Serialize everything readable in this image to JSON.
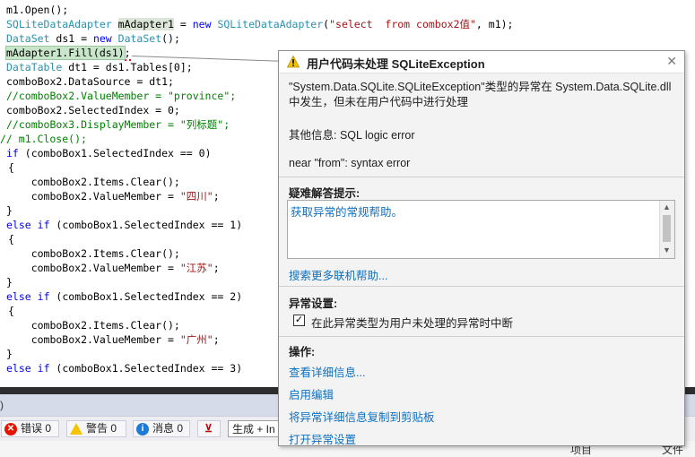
{
  "code": {
    "lines": [
      [
        {
          "t": "m1.Open();",
          "c": ""
        }
      ],
      [
        {
          "t": "SQLiteDataAdapter",
          "c": "ty"
        },
        {
          "t": " ",
          "c": ""
        },
        {
          "t": "mAdapter1",
          "c": "hl-var"
        },
        {
          "t": " = ",
          "c": ""
        },
        {
          "t": "new",
          "c": "kw"
        },
        {
          "t": " ",
          "c": ""
        },
        {
          "t": "SQLiteDataAdapter",
          "c": "ty"
        },
        {
          "t": "(",
          "c": ""
        },
        {
          "t": "\"select  from combox2值\"",
          "c": "st"
        },
        {
          "t": ", m1);",
          "c": ""
        }
      ],
      [
        {
          "t": "DataSet",
          "c": "ty"
        },
        {
          "t": " ds1 = ",
          "c": ""
        },
        {
          "t": "new",
          "c": "kw"
        },
        {
          "t": " ",
          "c": ""
        },
        {
          "t": "DataSet",
          "c": "ty"
        },
        {
          "t": "();",
          "c": ""
        }
      ],
      [
        {
          "t": "mAdapter1.Fill(ds1)",
          "c": "hl-fill"
        },
        {
          "t": ";",
          "c": "squiggle"
        }
      ],
      [
        {
          "t": "DataTable",
          "c": "ty"
        },
        {
          "t": " dt1 = ds1.Tables[0];",
          "c": ""
        }
      ],
      [
        {
          "t": "comboBox2.DataSource = dt1;",
          "c": ""
        }
      ],
      [
        {
          "t": "//comboBox2.ValueMember = \"province\";",
          "c": "cm"
        }
      ],
      [
        {
          "t": "comboBox2.SelectedIndex = 0;",
          "c": ""
        }
      ],
      [
        {
          "t": "//comboBox3.DisplayMember = \"列标题\";",
          "c": "cm"
        }
      ],
      [
        {
          "t": "// m1.Close();",
          "c": "cm"
        }
      ],
      [
        {
          "t": "if",
          "c": "kw"
        },
        {
          "t": " (comboBox1.SelectedIndex == 0)",
          "c": ""
        }
      ],
      [
        {
          "t": "{",
          "c": ""
        }
      ],
      [
        {
          "t": "    comboBox2.Items.Clear();",
          "c": ""
        }
      ],
      [
        {
          "t": "    comboBox2.ValueMember = ",
          "c": ""
        },
        {
          "t": "\"四川\"",
          "c": "st"
        },
        {
          "t": ";",
          "c": ""
        }
      ],
      [
        {
          "t": "}",
          "c": ""
        }
      ],
      [
        {
          "t": "else",
          "c": "kw"
        },
        {
          "t": " ",
          "c": ""
        },
        {
          "t": "if",
          "c": "kw"
        },
        {
          "t": " (comboBox1.SelectedIndex == 1)",
          "c": ""
        }
      ],
      [
        {
          "t": "{",
          "c": ""
        }
      ],
      [
        {
          "t": "    comboBox2.Items.Clear();",
          "c": ""
        }
      ],
      [
        {
          "t": "    comboBox2.ValueMember = ",
          "c": ""
        },
        {
          "t": "\"江苏\"",
          "c": "st"
        },
        {
          "t": ";",
          "c": ""
        }
      ],
      [
        {
          "t": "}",
          "c": ""
        }
      ],
      [
        {
          "t": "else",
          "c": "kw"
        },
        {
          "t": " ",
          "c": ""
        },
        {
          "t": "if",
          "c": "kw"
        },
        {
          "t": " (comboBox1.SelectedIndex == 2)",
          "c": ""
        }
      ],
      [
        {
          "t": "{",
          "c": ""
        }
      ],
      [
        {
          "t": "    comboBox2.Items.Clear();",
          "c": ""
        }
      ],
      [
        {
          "t": "    comboBox2.ValueMember = ",
          "c": ""
        },
        {
          "t": "\"广州\"",
          "c": "st"
        },
        {
          "t": ";",
          "c": ""
        }
      ],
      [
        {
          "t": "}",
          "c": ""
        }
      ],
      [
        {
          "t": "else",
          "c": "kw"
        },
        {
          "t": " ",
          "c": ""
        },
        {
          "t": "if",
          "c": "kw"
        },
        {
          "t": " (comboBox1.SelectedIndex == 3)",
          "c": ""
        }
      ]
    ],
    "indent": [
      7,
      7,
      7,
      7,
      7,
      7,
      7,
      7,
      7,
      0,
      7,
      9,
      7,
      7,
      7,
      7,
      9,
      7,
      7,
      7,
      7,
      9,
      7,
      7,
      7,
      7
    ]
  },
  "exception": {
    "title": "用户代码未处理 SQLiteException",
    "message": "\"System.Data.SQLite.SQLiteException\"类型的异常在 System.Data.SQLite.dll 中发生，但未在用户代码中进行处理",
    "additional_info": "其他信息: SQL logic error",
    "detail": "near \"from\": syntax error",
    "tips_label": "疑难解答提示:",
    "tips_link": "获取异常的常规帮助。",
    "search_online_link": "搜索更多联机帮助...",
    "settings_label": "异常设置:",
    "break_checkbox_label": "在此异常类型为用户未处理的异常时中断",
    "break_checkbox_checked": true,
    "actions_label": "操作:",
    "actions": [
      "查看详细信息...",
      "启用编辑",
      "将异常详细信息复制到剪贴板",
      "打开异常设置"
    ]
  },
  "error_list": {
    "errors_label": "错误 0",
    "warnings_label": "警告 0",
    "messages_label": "消息 0",
    "scope_value": "生成 + In",
    "tab_close": ")"
  },
  "bottom_strip": {
    "col_a": "项目",
    "col_b": "文件"
  },
  "colors": {
    "keyword": "#0000ff",
    "type": "#2b91af",
    "string": "#a31515",
    "comment": "#008000",
    "link": "#0e70c0",
    "warning": "#f5c400",
    "error": "#e51400"
  }
}
